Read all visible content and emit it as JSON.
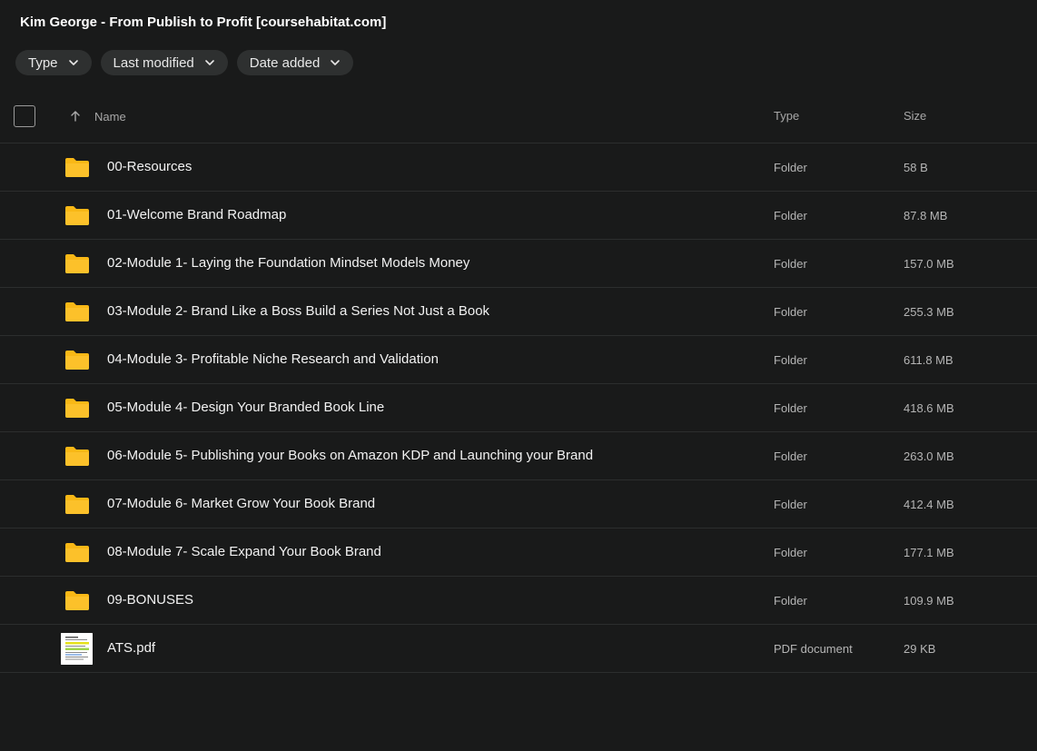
{
  "title": "Kim George - From Publish to Profit [coursehabitat.com]",
  "filters": [
    {
      "label": "Type",
      "icon": "chevron-down-icon"
    },
    {
      "label": "Last modified",
      "icon": "chevron-down-icon"
    },
    {
      "label": "Date added",
      "icon": "chevron-down-icon"
    }
  ],
  "columns": {
    "sort_icon": "arrow-up-icon",
    "name": "Name",
    "type": "Type",
    "size": "Size"
  },
  "rows": [
    {
      "name": "00-Resources",
      "type": "Folder",
      "size": "58 B",
      "icon": "folder-icon"
    },
    {
      "name": "01-Welcome Brand Roadmap",
      "type": "Folder",
      "size": "87.8 MB",
      "icon": "folder-icon"
    },
    {
      "name": "02-Module 1- Laying the Foundation Mindset Models Money",
      "type": "Folder",
      "size": "157.0 MB",
      "icon": "folder-icon"
    },
    {
      "name": "03-Module 2- Brand Like a Boss Build a Series Not Just a Book",
      "type": "Folder",
      "size": "255.3 MB",
      "icon": "folder-icon"
    },
    {
      "name": "04-Module 3- Profitable Niche Research and Validation",
      "type": "Folder",
      "size": "611.8 MB",
      "icon": "folder-icon"
    },
    {
      "name": "05-Module 4- Design Your Branded Book Line",
      "type": "Folder",
      "size": "418.6 MB",
      "icon": "folder-icon"
    },
    {
      "name": "06-Module 5- Publishing your Books on Amazon KDP and Launching your Brand",
      "type": "Folder",
      "size": "263.0 MB",
      "icon": "folder-icon"
    },
    {
      "name": "07-Module 6- Market Grow Your Book Brand",
      "type": "Folder",
      "size": "412.4 MB",
      "icon": "folder-icon"
    },
    {
      "name": "08-Module 7- Scale Expand Your Book Brand",
      "type": "Folder",
      "size": "177.1 MB",
      "icon": "folder-icon"
    },
    {
      "name": "09-BONUSES",
      "type": "Folder",
      "size": "109.9 MB",
      "icon": "folder-icon"
    },
    {
      "name": "ATS.pdf",
      "type": "PDF document",
      "size": "29 KB",
      "icon": "pdf-thumbnail"
    }
  ],
  "colors": {
    "background": "#191a1a",
    "chip": "#2e3030",
    "divider": "#2c2e2e",
    "folder": "#f9b816"
  }
}
